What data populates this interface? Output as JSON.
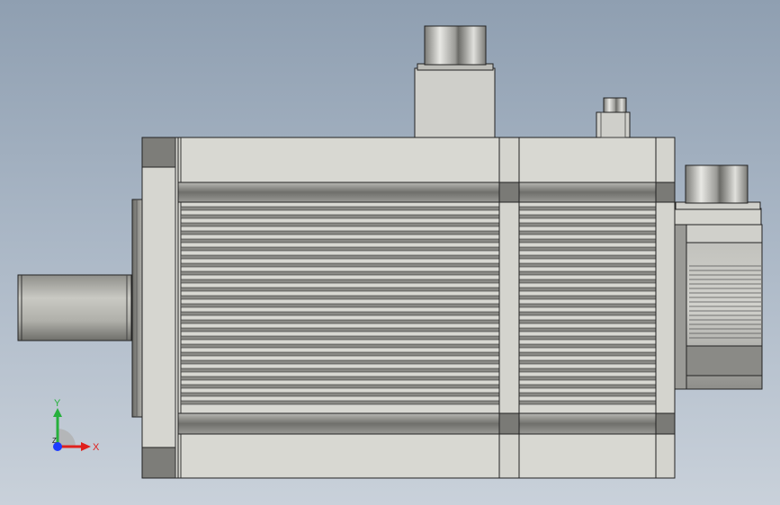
{
  "viewport": {
    "background_top": "#8f9fb1",
    "background_bottom": "#c9d1da"
  },
  "model": {
    "body_color": "#d8d8d2",
    "dark_band_color": "#7c7c78",
    "shaft_color": "#b9b9b3",
    "connector_color": "#cfcfcf"
  },
  "triad": {
    "x_label": "X",
    "y_label": "Y",
    "z_label": "Z",
    "x_color": "#e0201c",
    "y_color": "#26b03c",
    "z_color": "#1c3cff"
  }
}
